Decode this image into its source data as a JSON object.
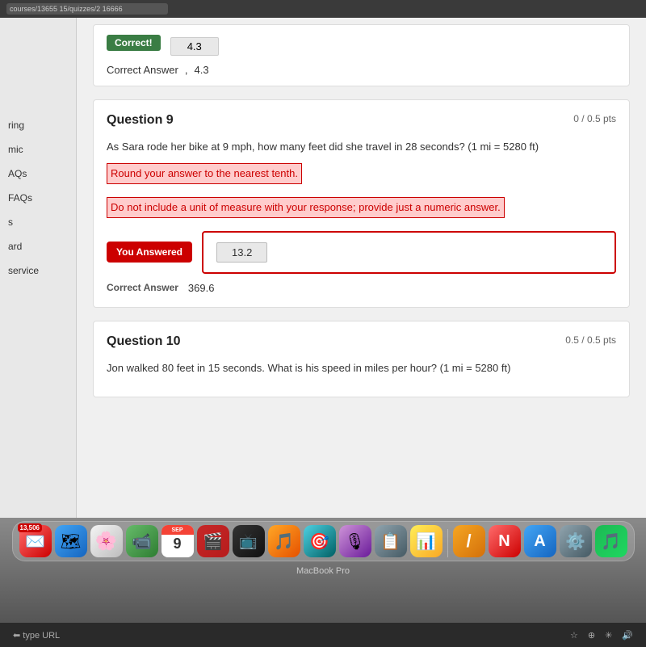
{
  "browser": {
    "url": "courses/13655 15/quizzes/2 16666"
  },
  "sidebar": {
    "items": [
      {
        "label": "ring"
      },
      {
        "label": "mic"
      },
      {
        "label": "AQs"
      },
      {
        "label": "FAQs"
      },
      {
        "label": "s"
      },
      {
        "label": "ard"
      },
      {
        "label": "service"
      }
    ]
  },
  "prev_question": {
    "correct_badge": "Correct!",
    "answer_value": "4.3",
    "correct_answer_label": "Correct Answer",
    "correct_answer_comma": ",",
    "correct_answer_value": "4.3"
  },
  "question9": {
    "title": "Question 9",
    "points": "0 / 0.5 pts",
    "question_text": "As Sara rode her bike at 9 mph, how many feet did she travel in 28 seconds? (1 mi = 5280 ft)",
    "instruction1": "Round your answer to the nearest tenth.",
    "instruction2": "Do not include a unit of measure with your response; provide just a numeric answer.",
    "you_answered_label": "You Answered",
    "user_answer": "13.2",
    "correct_answer_label": "Correct Answer",
    "correct_answer_value": "369.6"
  },
  "question10": {
    "title": "Question 10",
    "points": "0.5 / 0.5 pts",
    "question_text": "Jon walked 80 feet in 15 seconds. What is his speed in miles per hour? (1 mi = 5280 ft)"
  },
  "dock": {
    "label": "MacBook Pro",
    "calendar_month": "SEP",
    "calendar_day": "9",
    "badge_count": "13,506"
  },
  "bottom_bar": {
    "left_text": "type URL",
    "icons": [
      "star",
      "plus",
      "asterisk",
      "volume"
    ]
  }
}
